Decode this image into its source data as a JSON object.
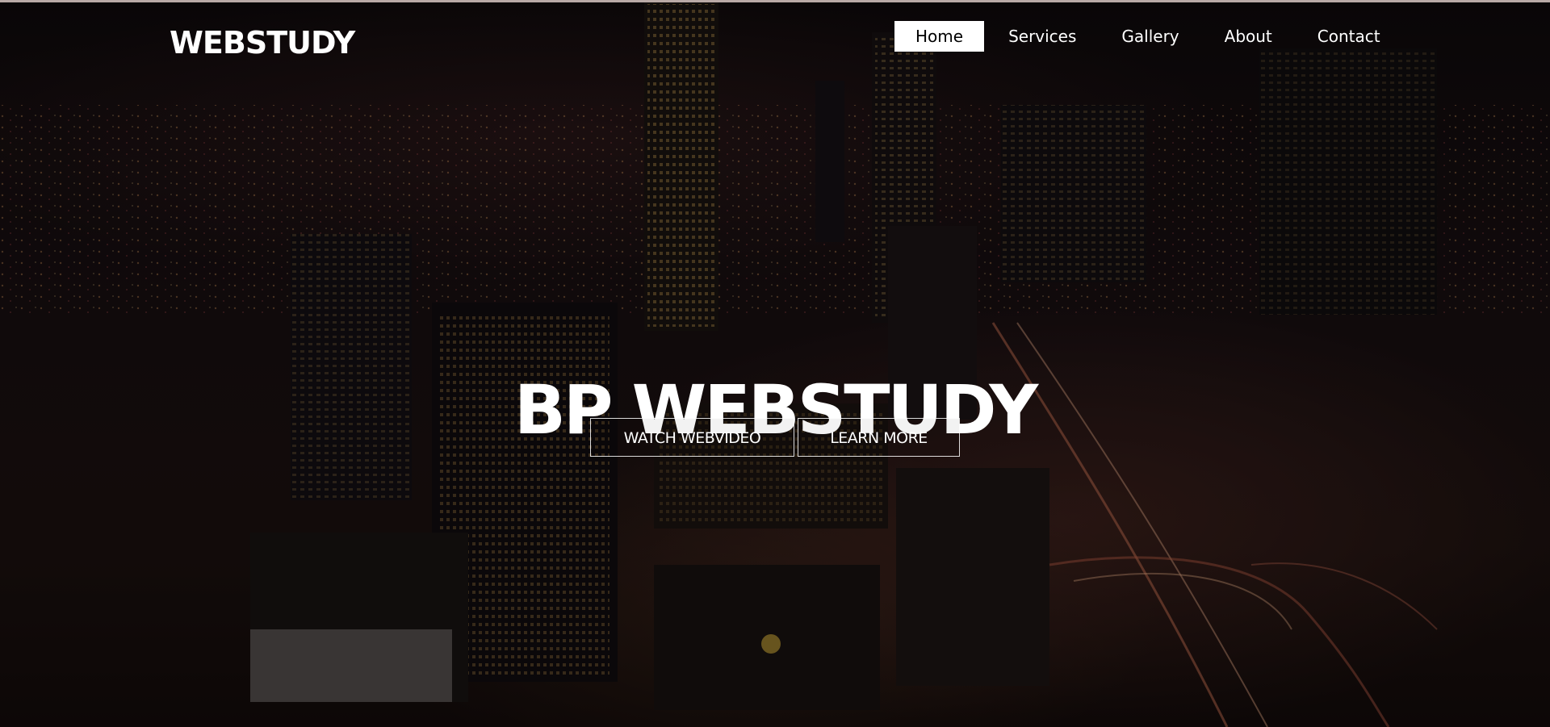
{
  "header": {
    "logo": "WEBSTUDY",
    "nav": [
      {
        "label": "Home",
        "active": true
      },
      {
        "label": "Services",
        "active": false
      },
      {
        "label": "Gallery",
        "active": false
      },
      {
        "label": "About",
        "active": false
      },
      {
        "label": "Contact",
        "active": false
      }
    ]
  },
  "hero": {
    "title": "BP WEBSTUDY",
    "buttons": {
      "watch_label": "WATCH WEBVIDEO",
      "learn_label": "LEARN MORE"
    },
    "background": "night-city-skyline-image"
  },
  "colors": {
    "nav_active_bg": "#ffffff",
    "text": "#ffffff",
    "overlay": "#000000"
  }
}
